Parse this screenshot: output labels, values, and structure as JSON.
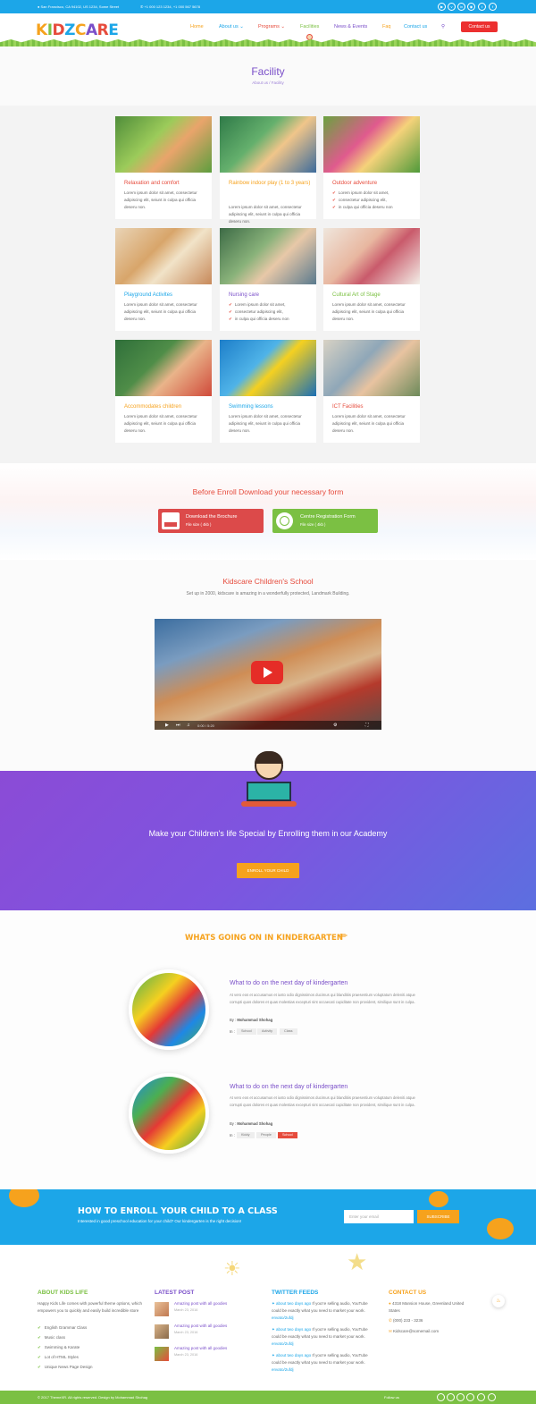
{
  "topbar": {
    "address": "San Francisco, CA 94102, US 1234, Some Street",
    "phones": "+1 000 123 1234, +1 000 567 5678",
    "social": [
      "yt",
      "vm",
      "in",
      "ig",
      "tw",
      "f"
    ]
  },
  "header": {
    "logo": "KIDZCARE",
    "nav": [
      "Home",
      "About us",
      "Programs",
      "Facilities",
      "News & Events",
      "Faq",
      "Contact us"
    ],
    "cta": "Contact us"
  },
  "page": {
    "title": "Facility",
    "breadcrumb": "About us / Facility"
  },
  "facilities": [
    {
      "title": "Relaxation and comfort",
      "desc": "Lorem ipsum dolor sit amet, consectetur adipiscing elit, seiunt in culpa qui officia deseru non.",
      "list": []
    },
    {
      "title": "Rainbow indoor play (1 to 3 years)",
      "desc": "Lorem ipsum dolor sit amet, consectetur adipiscing elit, seiunt in culpa qui officia deseru non.",
      "list": []
    },
    {
      "title": "Outdoor adventure",
      "desc": "",
      "list": [
        "Lorem ipsum dolor sit amet,",
        "consectetur adipiscing elit,",
        "in culpa qui officia deseru non"
      ]
    },
    {
      "title": "Playground Activites",
      "desc": "Lorem ipsum dolor sit amet, consectetur adipiscing elit, seiunt in culpa qui officia deseru non.",
      "list": []
    },
    {
      "title": "Nursing care",
      "desc": "",
      "list": [
        "Lorem ipsum dolor sit amet,",
        "consectetur adipiscing elit,",
        "in culpa qui officia deseru non"
      ]
    },
    {
      "title": "Cultural Art of Stage",
      "desc": "Lorem ipsum dolor sit amet, consectetur adipiscing elit, seiunt in culpa qui officia deseru non.",
      "list": []
    },
    {
      "title": "Accommodates children",
      "desc": "Lorem ipsum dolor sit amet, consectetur adipiscing elit, seiunt in culpa qui officia deseru non.",
      "list": []
    },
    {
      "title": "Swimming lessons",
      "desc": "Lorem ipsum dolor sit amet, consectetur adipiscing elit, seiunt in culpa qui officia deseru non.",
      "list": []
    },
    {
      "title": "ICT Facilities",
      "desc": "Lorem ipsum dolor sit amet, consectetur adipiscing elit, seiunt in culpa qui officia deseru non.",
      "list": []
    }
  ],
  "facility_colors": [
    "#e64b3c",
    "#f6a21d",
    "#e64b3c",
    "#1ca6e8",
    "#7a4fc9",
    "#7bc043",
    "#f6a21d",
    "#1ca6e8",
    "#e64b3c"
  ],
  "download": {
    "heading": "Before Enroll Download your necessary form",
    "buttons": [
      {
        "label": "Download the Brochure",
        "size": "File size ( 4kb )",
        "color": "#dc4a4a"
      },
      {
        "label": "Centre Registration Form",
        "size": "File size ( 4kb )",
        "color": "#7bc043"
      }
    ]
  },
  "school": {
    "title": "Kidscare Children's School",
    "subtitle": "Set up in 2000, kidscare is amazing in a wonderfully protected, Landmark Building.",
    "video_time": "0:00 / 5:20"
  },
  "academy": {
    "heading": "Make your Children's life Special by Enrolling them in our Academy",
    "button": "ENROLL YOUR CHILD"
  },
  "news": {
    "heading": "WHATS GOING ON IN KINDERGARTEN",
    "items": [
      {
        "title": "What to do on the next day of kindergarten",
        "text": "At vero eos et accusamus et iusto odio dignissimos ducimus qui blanditiis praesentium voluptatum deleniti atque corrupti quos dolores et quas molestias excepturi sint occaecati cupiditate non provident, similique sunt in culpa.",
        "by_label": "By :",
        "author": "Mohammad Shohag",
        "tags_label": "In :",
        "tags": [
          "School",
          "Activity",
          "Class"
        ]
      },
      {
        "title": "What to do on the next day of kindergarten",
        "text": "At vero eos et accusamus et iusto odio dignissimos ducimus qui blanditiis praesentium voluptatum deleniti atque corrupti quos dolores et quas molestias excepturi sint occaecati cupiditate non provident, similique sunt in culpa.",
        "by_label": "By :",
        "author": "Mohammad Shohag",
        "tags_label": "In :",
        "tags": [
          "Kiddy",
          "People",
          "School"
        ]
      }
    ]
  },
  "how": {
    "heading": "HOW TO ENROLL YOUR CHILD TO A CLASS",
    "sub": "Interested in good preschool education for your child? Our kindergarten is the right decision!",
    "placeholder": "Enter your email",
    "button": "SUBSCRIBE"
  },
  "footer": {
    "about": {
      "title": "ABOUT KIDS LIFE",
      "text": "Happy Kids Life comes with powerful theme options, which empowers you to quickly and easily build incredible store",
      "list": [
        "English Grammar Class",
        "Music class",
        "Swimming & Karate",
        "Lot of HTML Styles",
        "Unique News Page Design"
      ]
    },
    "latest": {
      "title": "LATEST POST",
      "posts": [
        {
          "title": "Amazing post with all goodies",
          "date": "March 23, 2016"
        },
        {
          "title": "Amazing post with all goodies",
          "date": "March 23, 2016"
        },
        {
          "title": "Amazing post with all goodies",
          "date": "March 23, 2016"
        }
      ]
    },
    "twitter": {
      "title": "TWITTER FEEDS",
      "tweets": [
        {
          "time": "about two days ago",
          "text": "If you're selling audio, YouTube could be exactly what you need to market your work.",
          "link": "envato/2ufdj"
        },
        {
          "time": "about two days ago",
          "text": "If you're selling audio, YouTube could be exactly what you need to market your work.",
          "link": "envato/2ufdj"
        },
        {
          "time": "about two days ago",
          "text": "If you're selling audio, YouTube could be exactly what you need to market your work.",
          "link": "envato/2ufdj"
        }
      ]
    },
    "contact": {
      "title": "CONTACT US",
      "address": "4318 Mansion House, Greenland United States",
      "phone": "(000) 233 - 3236",
      "email": "Kidscare@somemail.com"
    },
    "copyright": "© 2017 ThemeXR. All rights reserved. Design by Mohammad Shohag",
    "follow": "Follow us"
  }
}
